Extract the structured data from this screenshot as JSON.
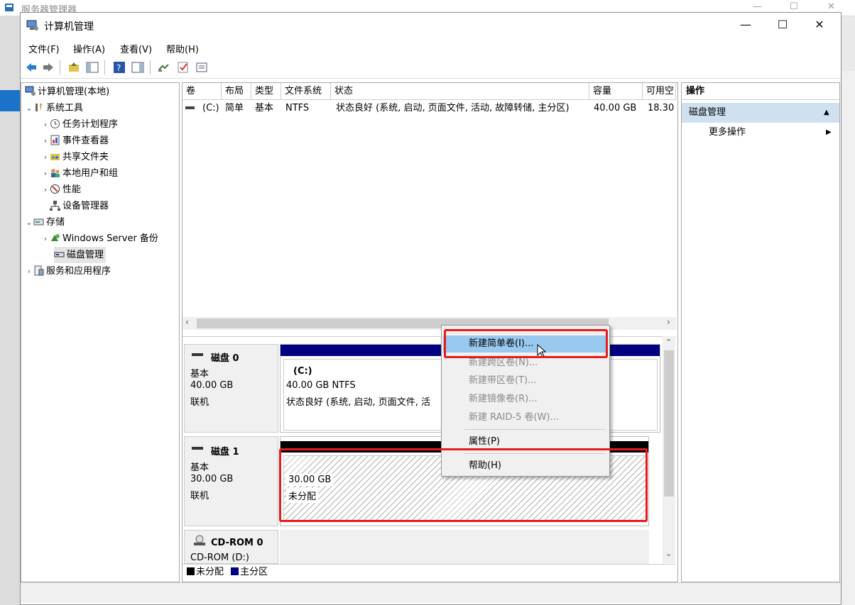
{
  "background_window": {
    "title": "服务器管理器"
  },
  "window": {
    "title": "计算机管理",
    "controls": {
      "minimize": "—",
      "maximize": "☐",
      "close": "✕"
    }
  },
  "menu": [
    "文件(F)",
    "操作(A)",
    "查看(V)",
    "帮助(H)"
  ],
  "tree": {
    "root": "计算机管理(本地)",
    "system_tools": "系统工具",
    "task_scheduler": "任务计划程序",
    "event_viewer": "事件查看器",
    "shared_folders": "共享文件夹",
    "local_users": "本地用户和组",
    "performance": "性能",
    "device_manager": "设备管理器",
    "storage": "存储",
    "backup": "Windows Server 备份",
    "disk_management": "磁盘管理",
    "services": "服务和应用程序"
  },
  "volume_table": {
    "headers": [
      "卷",
      "布局",
      "类型",
      "文件系统",
      "状态",
      "容量",
      "可用空"
    ],
    "row": {
      "volume": "(C:)",
      "layout": "简单",
      "type": "基本",
      "fs": "NTFS",
      "status": "状态良好 (系统, 启动, 页面文件, 活动, 故障转储, 主分区)",
      "capacity": "40.00 GB",
      "free": "18.30"
    }
  },
  "disks": {
    "disk0": {
      "name": "磁盘 0",
      "type": "基本",
      "size": "40.00 GB",
      "state": "联机",
      "partition": {
        "label": "(C:)",
        "size_fs": "40.00 GB NTFS",
        "status": "状态良好 (系统, 启动, 页面文件, 活"
      }
    },
    "disk1": {
      "name": "磁盘 1",
      "type": "基本",
      "size": "30.00 GB",
      "state": "联机",
      "partition": {
        "size": "30.00 GB",
        "status": "未分配"
      }
    },
    "cdrom": {
      "name": "CD-ROM 0",
      "drive": "CD-ROM (D:)"
    }
  },
  "legend": {
    "unallocated": "未分配",
    "primary": "主分区"
  },
  "actions": {
    "header": "操作",
    "section": "磁盘管理",
    "more": "更多操作"
  },
  "context_menu": {
    "new_simple": "新建简单卷(I)...",
    "new_spanned": "新建跨区卷(N)...",
    "new_striped": "新建带区卷(T)...",
    "new_mirrored": "新建镜像卷(R)...",
    "new_raid5": "新建 RAID-5 卷(W)...",
    "properties": "属性(P)",
    "help": "帮助(H)"
  },
  "colors": {
    "primary_partition": "#000080",
    "unallocated": "#000000",
    "highlight": "#99c9ef",
    "red_annotation": "#e81b1b"
  }
}
